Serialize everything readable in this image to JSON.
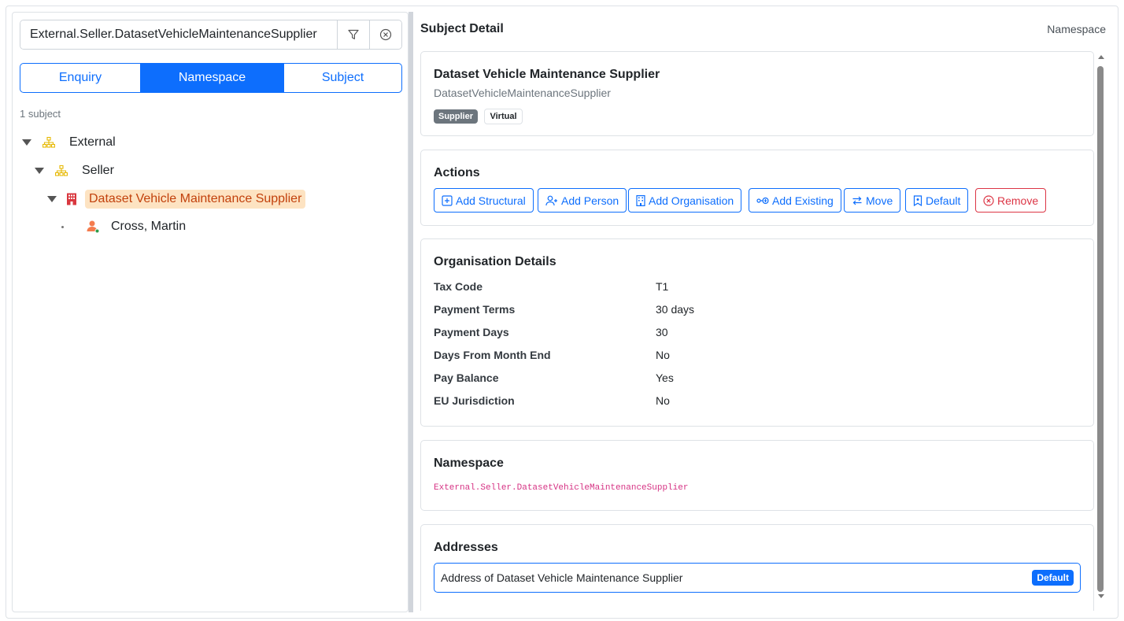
{
  "search": {
    "value": "External.Seller.DatasetVehicleMaintenanceSupplier"
  },
  "tabs": [
    {
      "label": "Enquiry"
    },
    {
      "label": "Namespace"
    },
    {
      "label": "Subject"
    }
  ],
  "subject_count": "1 subject",
  "tree": {
    "root": "External",
    "child": "Seller",
    "selected": "Dataset Vehicle Maintenance Supplier",
    "person": "Cross, Martin"
  },
  "detail": {
    "title": "Subject Detail",
    "context": "Namespace",
    "name": "Dataset Vehicle Maintenance Supplier",
    "code": "DatasetVehicleMaintenanceSupplier",
    "badges": {
      "supplier": "Supplier",
      "virtual": "Virtual"
    }
  },
  "actions": {
    "title": "Actions",
    "add_structural": "Add Structural",
    "add_person": "Add Person",
    "add_organisation": "Add Organisation",
    "add_existing": "Add Existing",
    "move": "Move",
    "default": "Default",
    "remove": "Remove"
  },
  "org_details": {
    "title": "Organisation Details",
    "rows": [
      {
        "key": "Tax Code",
        "value": "T1"
      },
      {
        "key": "Payment Terms",
        "value": "30 days"
      },
      {
        "key": "Payment Days",
        "value": "30"
      },
      {
        "key": "Days From Month End",
        "value": "No"
      },
      {
        "key": "Pay Balance",
        "value": "Yes"
      },
      {
        "key": "EU Jurisdiction",
        "value": "No"
      }
    ]
  },
  "namespace": {
    "title": "Namespace",
    "value": "External.Seller.DatasetVehicleMaintenanceSupplier"
  },
  "addresses": {
    "title": "Addresses",
    "item": "Address of Dataset Vehicle Maintenance Supplier",
    "badge": "Default"
  },
  "colors": {
    "accent": "#0d6efd",
    "danger": "#dc3545",
    "selected_bg": "#fde3c2",
    "selected_text": "#c2410c"
  }
}
